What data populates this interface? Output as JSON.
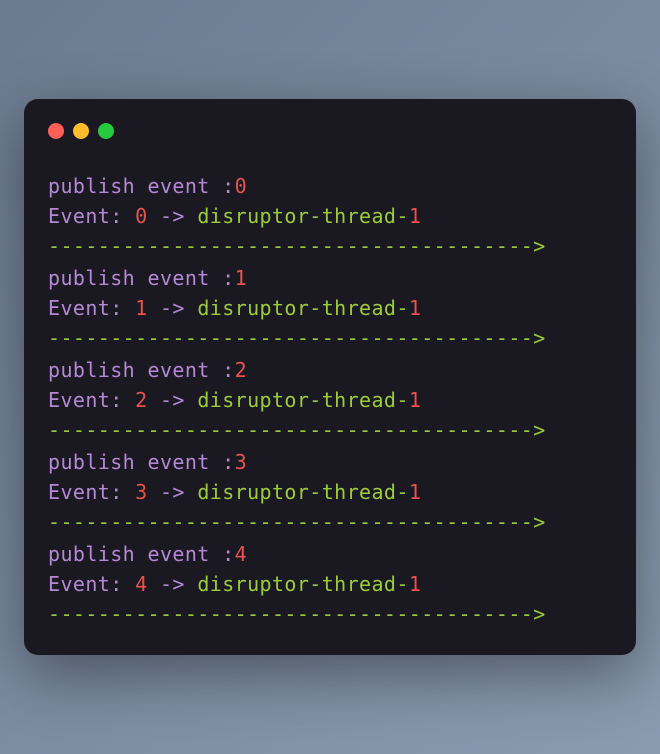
{
  "colors": {
    "purple": "#b589d6",
    "red": "#e8524f",
    "green": "#9ccc3c"
  },
  "terminal": {
    "entries": [
      {
        "publish_label": "publish event :",
        "publish_num": "0",
        "event_label": "Event: ",
        "event_num": "0",
        "arrow": " -> ",
        "thread_prefix": "disruptor-thread-",
        "thread_num": "1",
        "separator": "--------------------------------------->"
      },
      {
        "publish_label": "publish event :",
        "publish_num": "1",
        "event_label": "Event: ",
        "event_num": "1",
        "arrow": " -> ",
        "thread_prefix": "disruptor-thread-",
        "thread_num": "1",
        "separator": "--------------------------------------->"
      },
      {
        "publish_label": "publish event :",
        "publish_num": "2",
        "event_label": "Event: ",
        "event_num": "2",
        "arrow": " -> ",
        "thread_prefix": "disruptor-thread-",
        "thread_num": "1",
        "separator": "--------------------------------------->"
      },
      {
        "publish_label": "publish event :",
        "publish_num": "3",
        "event_label": "Event: ",
        "event_num": "3",
        "arrow": " -> ",
        "thread_prefix": "disruptor-thread-",
        "thread_num": "1",
        "separator": "--------------------------------------->"
      },
      {
        "publish_label": "publish event :",
        "publish_num": "4",
        "event_label": "Event: ",
        "event_num": "4",
        "arrow": " -> ",
        "thread_prefix": "disruptor-thread-",
        "thread_num": "1",
        "separator": "--------------------------------------->"
      }
    ]
  }
}
